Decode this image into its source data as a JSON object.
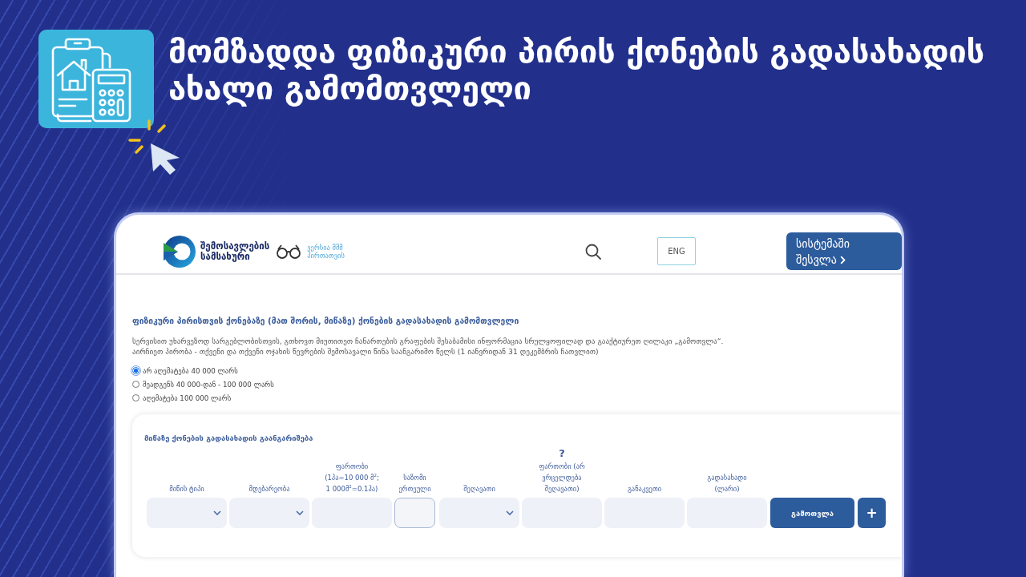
{
  "banner": {
    "headline": "მომზადდა ფიზიკური პირის ქონების გადასახადის ახალი გამომთვლელი"
  },
  "site": {
    "header": {
      "logo_text": "შემოსავლების სამსახური",
      "accessibility_link": "ვერსია შშმ პირთათვის",
      "language_button": "ENG",
      "login_button": "სისტემაში შესვლა"
    },
    "heading": "ფიზიკური პირისთვის ქონებაზე (მათ შორის, მიწაზე) ქონების გადასახადის გამომთვლელი",
    "instructions": [
      "სერვისით უხარვეზოდ სარგებლობისთვის, გთხოვთ მიუთითეთ ჩანართების გრაფების შესაბამისი ინფორმაცია სრულყოფილად და გააქტიურეთ ღილაკი „გამოთვლა“.",
      "აირჩიეთ პირობა - თქვენი და თქვენი ოჯახის წევრების შემოსავალი წინა საანგარიშო წელს (1 იანვრიდან 31 დეკემბრის ჩათვლით)"
    ],
    "income_options": [
      {
        "label": "არ აღემატება 40 000 ლარს",
        "selected": true
      },
      {
        "label": "შეადგენს 40 000-დან - 100 000 ლარს",
        "selected": false
      },
      {
        "label": "აღემატება 100 000 ლარს",
        "selected": false
      }
    ],
    "land_card": {
      "title": "მიწაზე ქონების გადასახადის გაანგარიშება",
      "columns": [
        {
          "label": "მიწის ტიპი",
          "kind": "select"
        },
        {
          "label": "მდებარეობა",
          "kind": "select"
        },
        {
          "label": "ფართობი (1ჰა=10 000 მ$^{2}$; 1 000მ$^{2}$=0.1ჰა)",
          "kind": "input"
        },
        {
          "label": "საზომი ერთეული",
          "kind": "unit"
        },
        {
          "label": "შეღავათი",
          "kind": "select"
        },
        {
          "label": "ფართობი (არ ვრცელდება შეღავათი)",
          "kind": "input",
          "help": "?"
        },
        {
          "label": "განაკვეთი",
          "kind": "input"
        },
        {
          "label": "გადასახადი (ლარი)",
          "kind": "input"
        }
      ],
      "calculate_button": "გამოთვლა",
      "add_button": "+"
    }
  }
}
